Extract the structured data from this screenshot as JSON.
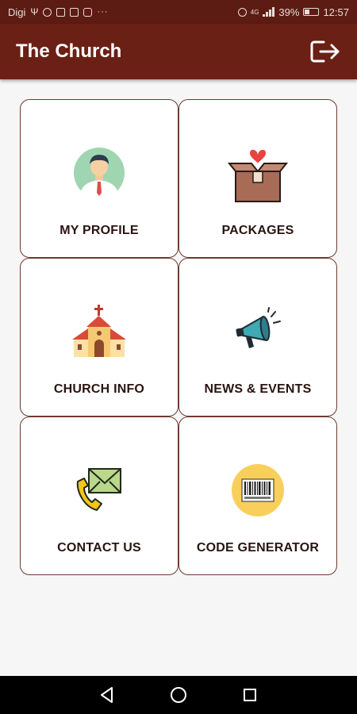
{
  "status_bar": {
    "carrier": "Digi",
    "network": "4G",
    "battery_percent": "39%",
    "time": "12:57",
    "left_icons": [
      "usb-icon",
      "whatsapp-icon",
      "image-icon",
      "mail-icon",
      "youtube-icon",
      "more-dots-icon"
    ],
    "right_icons": [
      "alarm-icon",
      "signal-icon",
      "battery-icon"
    ]
  },
  "app_bar": {
    "title": "The Church",
    "action_icon": "logout-icon"
  },
  "menu": {
    "items": [
      {
        "label": "MY PROFILE",
        "icon": "profile-avatar-icon"
      },
      {
        "label": "PACKAGES",
        "icon": "gift-box-heart-icon"
      },
      {
        "label": "CHURCH INFO",
        "icon": "church-icon"
      },
      {
        "label": "NEWS & EVENTS",
        "icon": "megaphone-icon"
      },
      {
        "label": "CONTACT US",
        "icon": "phone-envelope-icon"
      },
      {
        "label": "CODE GENERATOR",
        "icon": "barcode-icon"
      }
    ]
  },
  "nav_bar": {
    "buttons": [
      "back-icon",
      "home-icon",
      "recents-icon"
    ]
  },
  "colors": {
    "primary": "#6a2014",
    "status_bar": "#5d1c13",
    "card_border": "#6b3a30",
    "background": "#f6f6f6"
  }
}
